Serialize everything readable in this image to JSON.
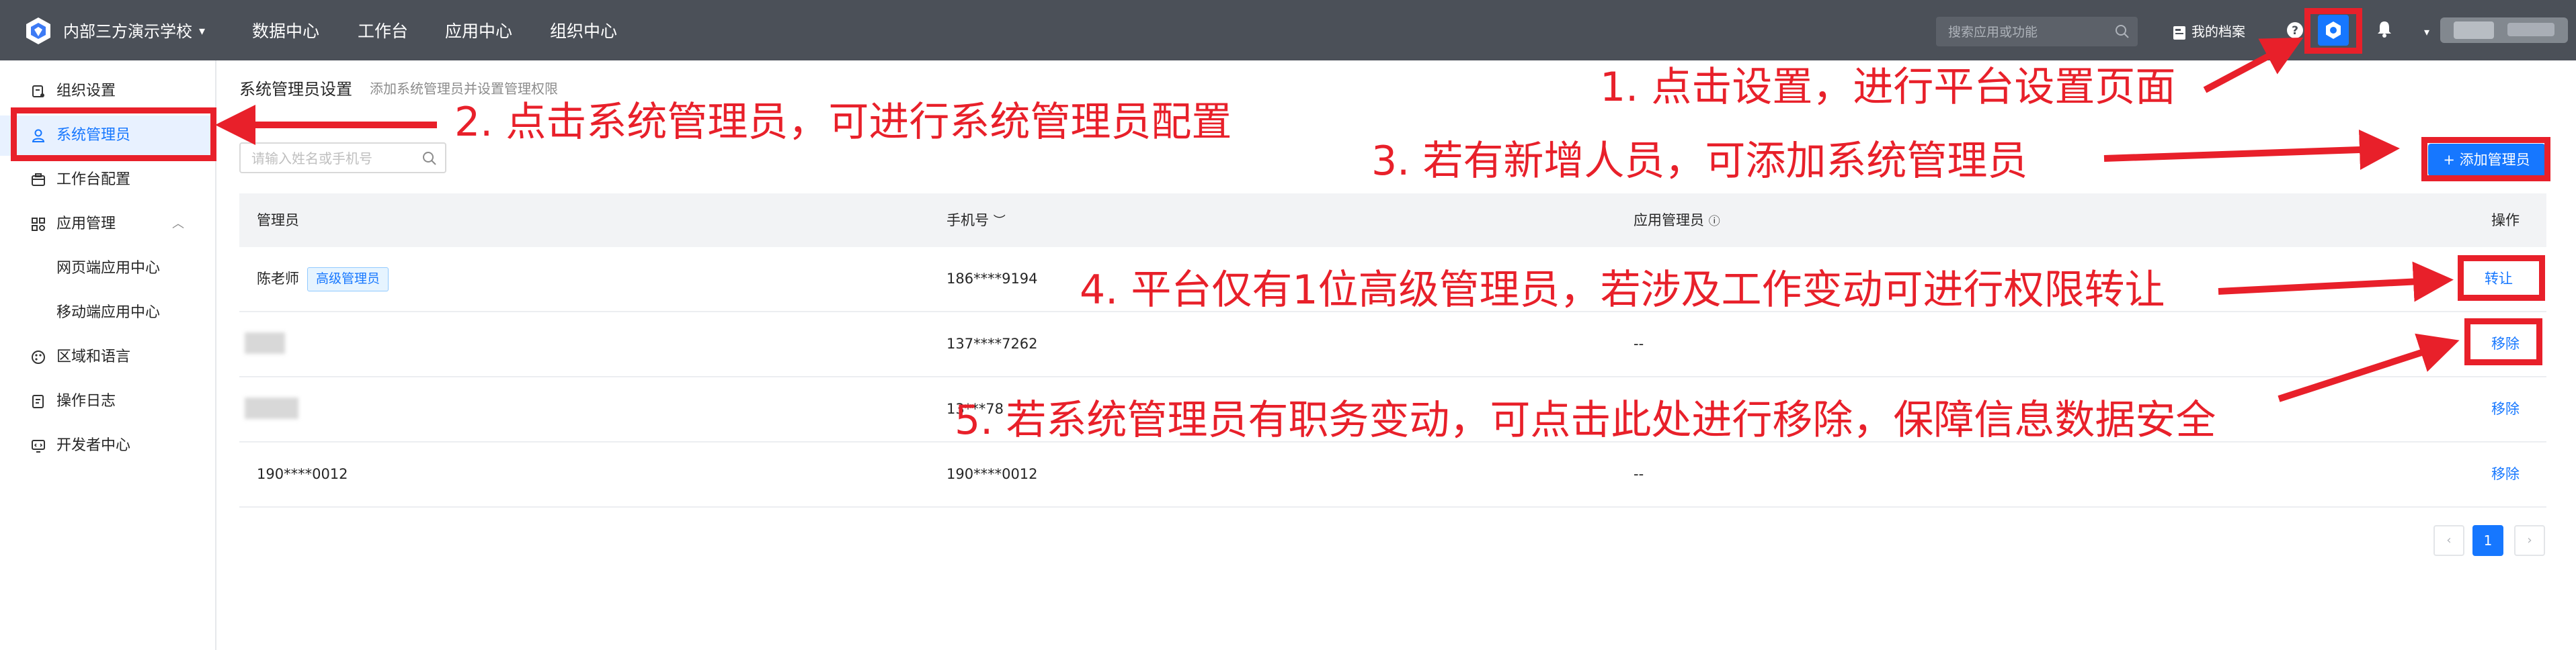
{
  "topbar": {
    "org_name": "内部三方演示学校",
    "nav": [
      "数据中心",
      "工作台",
      "应用中心",
      "组织中心"
    ],
    "search_placeholder": "搜索应用或功能",
    "profile_label": "我的档案",
    "accent": "#1677ff"
  },
  "sidebar": {
    "items": [
      {
        "label": "组织设置",
        "icon": "org-settings-icon"
      },
      {
        "label": "系统管理员",
        "icon": "admin-user-icon",
        "active": true
      },
      {
        "label": "工作台配置",
        "icon": "workbench-icon"
      },
      {
        "label": "应用管理",
        "icon": "apps-grid-icon",
        "expanded": true
      },
      {
        "label": "网页端应用中心",
        "sub": true
      },
      {
        "label": "移动端应用中心",
        "sub": true
      },
      {
        "label": "区域和语言",
        "icon": "globe-palette-icon"
      },
      {
        "label": "操作日志",
        "icon": "log-icon"
      },
      {
        "label": "开发者中心",
        "icon": "developer-icon"
      }
    ]
  },
  "main": {
    "title": "系统管理员设置",
    "subtitle": "添加系统管理员并设置管理权限",
    "filter_placeholder": "请输入姓名或手机号",
    "add_button": "+ 添加管理员",
    "table": {
      "headers": [
        "管理员",
        "手机号",
        "应用管理员",
        "操作"
      ],
      "rows": [
        {
          "name": "陈老师",
          "tag": "高级管理员",
          "phone": "186****9194",
          "app_admin": "",
          "action": "转让"
        },
        {
          "name": "",
          "phone": "137****7262",
          "app_admin": "--",
          "action": "移除"
        },
        {
          "name": "",
          "phone": "13***78",
          "app_admin": "",
          "action": "移除"
        },
        {
          "name": "190****0012",
          "phone": "190****0012",
          "app_admin": "--",
          "action": "移除"
        }
      ]
    },
    "pagination": {
      "current": "1"
    }
  },
  "annotations": [
    "1. 点击设置，进行平台设置页面",
    "2. 点击系统管理员，可进行系统管理员配置",
    "3. 若有新增人员，可添加系统管理员",
    "4. 平台仅有1位高级管理员，若涉及工作变动可进行权限转让",
    "5. 若系统管理员有职务变动，可点击此处进行移除，保障信息数据安全"
  ],
  "annotation_color": "#e8202a"
}
